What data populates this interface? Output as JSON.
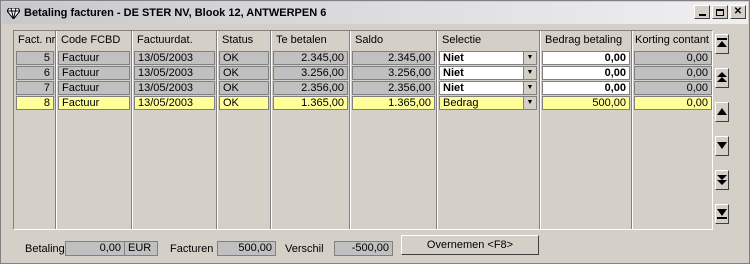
{
  "window": {
    "title": "Betaling facturen - DE STER NV, Blook 12, ANTWERPEN 6"
  },
  "columns": [
    "Fact. nr",
    "Code FCBD",
    "Factuurdat.",
    "Status",
    "Te betalen",
    "Saldo",
    "Selectie",
    "Bedrag betaling",
    "Korting contant"
  ],
  "rows": [
    {
      "nr": "5",
      "code": "Factuur",
      "date": "13/05/2003",
      "status": "OK",
      "te_betalen": "2.345,00",
      "saldo": "2.345,00",
      "selectie": "Niet",
      "bedrag": "0,00",
      "korting": "0,00",
      "highlight": false
    },
    {
      "nr": "6",
      "code": "Factuur",
      "date": "13/05/2003",
      "status": "OK",
      "te_betalen": "3.256,00",
      "saldo": "3.256,00",
      "selectie": "Niet",
      "bedrag": "0,00",
      "korting": "0,00",
      "highlight": false
    },
    {
      "nr": "7",
      "code": "Factuur",
      "date": "13/05/2003",
      "status": "OK",
      "te_betalen": "2.356,00",
      "saldo": "2.356,00",
      "selectie": "Niet",
      "bedrag": "0,00",
      "korting": "0,00",
      "highlight": false
    },
    {
      "nr": "8",
      "code": "Factuur",
      "date": "13/05/2003",
      "status": "OK",
      "te_betalen": "1.365,00",
      "saldo": "1.365,00",
      "selectie": "Bedrag",
      "bedrag": "500,00",
      "korting": "0,00",
      "highlight": true
    }
  ],
  "footer": {
    "betaling_label": "Betaling",
    "betaling_value": "0,00",
    "currency": "EUR",
    "facturen_label": "Facturen",
    "facturen_value": "500,00",
    "verschil_label": "Verschil",
    "verschil_value": "-500,00",
    "overnemen_label": "Overnemen <F8>"
  },
  "colors": {
    "highlight_row": "#ffff99",
    "window_bg": "#d4d0c8"
  },
  "icons": {
    "title": "diamond-app-icon",
    "minimize": "minimize-icon",
    "maximize": "maximize-icon",
    "close": "close-icon",
    "nav": [
      "first-record-icon",
      "page-up-icon",
      "prev-record-icon",
      "next-record-icon",
      "page-down-icon",
      "last-record-icon"
    ]
  }
}
